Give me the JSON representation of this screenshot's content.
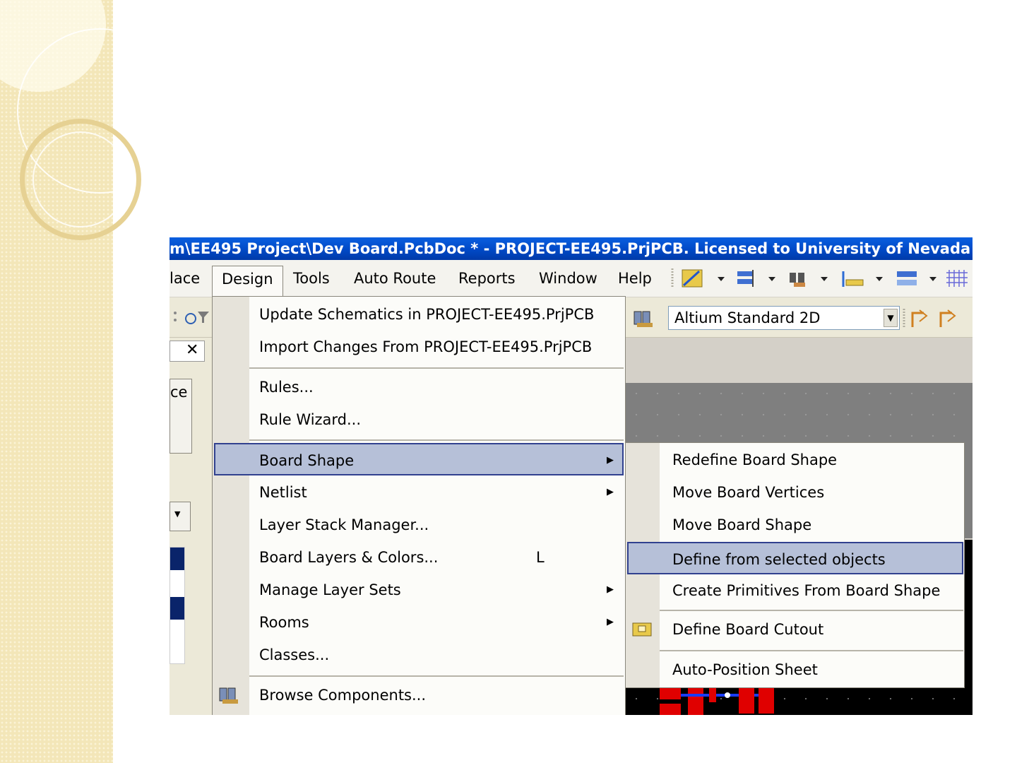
{
  "window": {
    "title": "m\\EE495 Project\\Dev Board.PcbDoc * - PROJECT-EE495.PrjPCB. Licensed to University of Nevada"
  },
  "menubar": {
    "items": [
      "lace",
      "Design",
      "Tools",
      "Auto Route",
      "Reports",
      "Window",
      "Help"
    ]
  },
  "toolbar": {
    "view_combo_value": "Altium Standard 2D"
  },
  "side_panel": {
    "button_label": "ce"
  },
  "design_menu": {
    "items": [
      {
        "label": "Update Schematics in PROJECT-EE495.PrjPCB"
      },
      {
        "label": "Import Changes From PROJECT-EE495.PrjPCB"
      },
      {
        "label": "Rules..."
      },
      {
        "label": "Rule Wizard..."
      },
      {
        "label": "Board Shape"
      },
      {
        "label": "Netlist"
      },
      {
        "label": "Layer Stack Manager..."
      },
      {
        "label": "Board Layers & Colors...",
        "shortcut": "L"
      },
      {
        "label": "Manage Layer Sets"
      },
      {
        "label": "Rooms"
      },
      {
        "label": "Classes..."
      },
      {
        "label": "Browse Components..."
      }
    ]
  },
  "board_shape_submenu": {
    "items": [
      {
        "label": "Redefine Board Shape"
      },
      {
        "label": "Move Board Vertices"
      },
      {
        "label": "Move Board Shape"
      },
      {
        "label": "Define from selected objects"
      },
      {
        "label": "Create Primitives From Board Shape"
      },
      {
        "label": "Define Board Cutout"
      },
      {
        "label": "Auto-Position Sheet"
      }
    ]
  },
  "icons": [
    "close-icon",
    "filter-icon",
    "browse-components-icon",
    "board-cutout-icon",
    "submenu-arrow-icon",
    "dropdown-arrow-icon",
    "grid-icon",
    "route-icon"
  ],
  "colors": {
    "title_bar": "#0054e3",
    "highlight_fill": "#b6c0d8",
    "highlight_border": "#31418f",
    "slide_strip": "#f3e6b8"
  }
}
